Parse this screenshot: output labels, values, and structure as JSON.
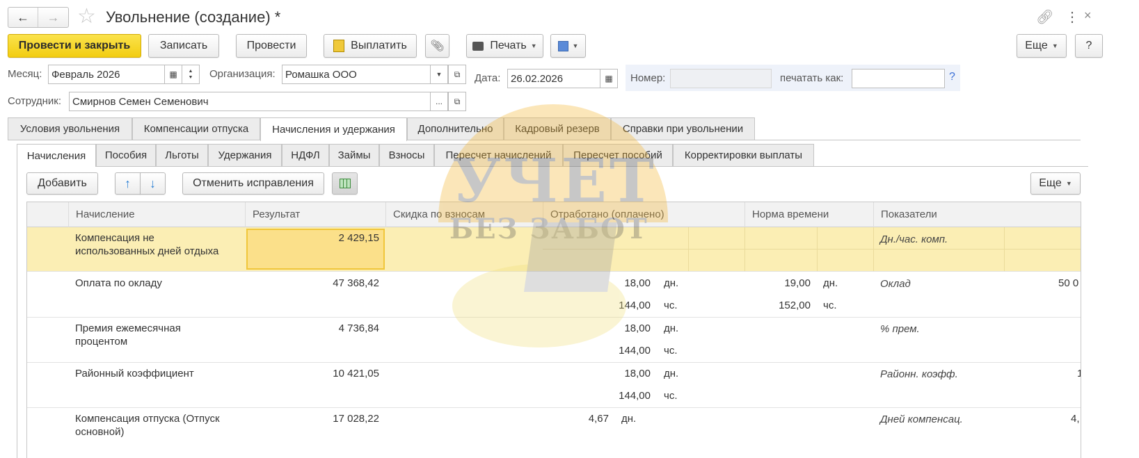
{
  "window": {
    "title": "Увольнение (создание) *"
  },
  "toolbar": {
    "post_close": "Провести и закрыть",
    "save": "Записать",
    "post": "Провести",
    "pay": "Выплатить",
    "print": "Печать",
    "more": "Еще",
    "help": "?"
  },
  "form": {
    "month_label": "Месяц:",
    "month_value": "Февраль 2026",
    "org_label": "Организация:",
    "org_value": "Ромашка ООО",
    "date_label": "Дата:",
    "date_value": "26.02.2026",
    "number_label": "Номер:",
    "number_value": "",
    "print_as_label": "печатать как:",
    "print_as_value": "",
    "help_mark": "?",
    "employee_label": "Сотрудник:",
    "employee_value": "Смирнов Семен Семенович",
    "ellipsis": "..."
  },
  "tabs": [
    "Условия увольнения",
    "Компенсации отпуска",
    "Начисления и удержания",
    "Дополнительно",
    "Кадровый резерв",
    "Справки при увольнении"
  ],
  "subtabs": [
    "Начисления",
    "Пособия",
    "Льготы",
    "Удержания",
    "НДФЛ",
    "Займы",
    "Взносы",
    "Пересчет начислений",
    "Пересчет пособий",
    "Корректировки выплаты"
  ],
  "table_toolbar": {
    "add": "Добавить",
    "cancel_fix": "Отменить исправления",
    "more": "Еще"
  },
  "table": {
    "columns": [
      "Начисление",
      "Результат",
      "Скидка по взносам",
      "Отработано (оплачено)",
      "Норма времени",
      "Показатели"
    ],
    "rows": [
      {
        "name1": "Компенсация не",
        "name2": "использованных дней отдыха",
        "result": "2 429,15",
        "w1": "",
        "w1u": "",
        "w2": "",
        "w2u": "",
        "n1": "",
        "n1u": "",
        "n2": "",
        "n2u": "",
        "ind": "Дн./час. комп.",
        "indval": ""
      },
      {
        "name1": "Оплата по окладу",
        "name2": "",
        "result": "47 368,42",
        "w1": "18,00",
        "w1u": "дн.",
        "w2": "144,00",
        "w2u": "чс.",
        "n1": "19,00",
        "n1u": "дн.",
        "n2": "152,00",
        "n2u": "чс.",
        "ind": "Оклад",
        "indval": "50 0"
      },
      {
        "name1": "Премия ежемесячная",
        "name2": "процентом",
        "result": "4 736,84",
        "w1": "18,00",
        "w1u": "дн.",
        "w2": "144,00",
        "w2u": "чс.",
        "n1": "",
        "n1u": "",
        "n2": "",
        "n2u": "",
        "ind": "% прем.",
        "indval": ""
      },
      {
        "name1": "Районный коэффициент",
        "name2": "",
        "result": "10 421,05",
        "w1": "18,00",
        "w1u": "дн.",
        "w2": "144,00",
        "w2u": "чс.",
        "n1": "",
        "n1u": "",
        "n2": "",
        "n2u": "",
        "ind": "Районн. коэфф.",
        "indval": "1"
      },
      {
        "name1": "Компенсация отпуска (Отпуск",
        "name2": "основной)",
        "result": "17 028,22",
        "w1": "4,67",
        "w1u": "дн.",
        "w2": "",
        "w2u": "",
        "n1": "",
        "n1u": "",
        "n2": "",
        "n2u": "",
        "ind": "Дней компенсац.",
        "indval": "4,"
      }
    ]
  },
  "watermark": {
    "line1": "УЧЕТ",
    "line2": "БЕЗ ЗАБОТ"
  },
  "colors": {
    "accent_yellow": "#f5d21b",
    "selected_row": "#fbeeb4",
    "selected_cell": "#fbe08a",
    "tab_inactive": "#ececec",
    "help_blue": "#3a6fd6"
  }
}
